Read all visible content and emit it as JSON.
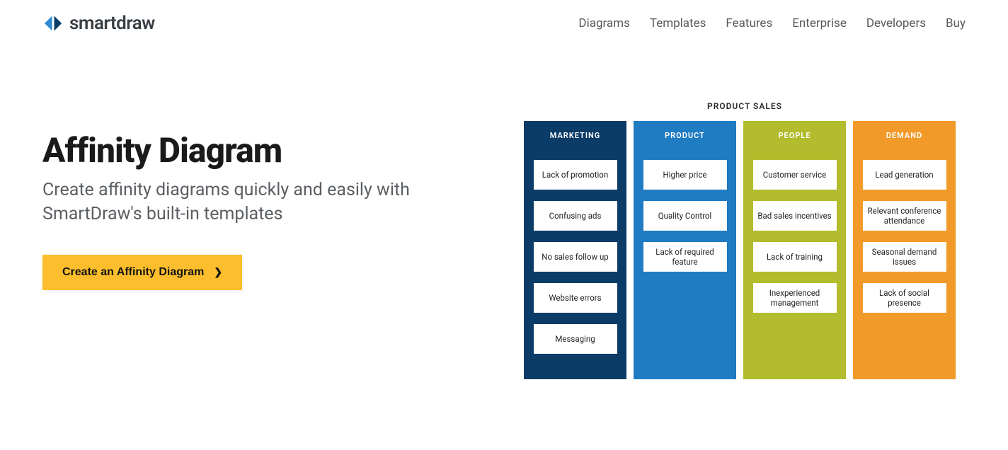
{
  "brand": "smartdraw",
  "nav": [
    "Diagrams",
    "Templates",
    "Features",
    "Enterprise",
    "Developers",
    "Buy"
  ],
  "hero": {
    "title": "Affinity Diagram",
    "subtitle": "Create affinity diagrams quickly and easily with SmartDraw's built-in templates",
    "cta": "Create an Affinity Diagram"
  },
  "diagram": {
    "title": "PRODUCT SALES",
    "columns": [
      {
        "name": "MARKETING",
        "color": "#0b3c68",
        "items": [
          "Lack of promotion",
          "Confusing ads",
          "No sales follow up",
          "Website errors",
          "Messaging"
        ]
      },
      {
        "name": "PRODUCT",
        "color": "#1f7bc2",
        "items": [
          "Higher price",
          "Quality Control",
          "Lack of required feature"
        ]
      },
      {
        "name": "PEOPLE",
        "color": "#b2bc2c",
        "items": [
          "Customer service",
          "Bad sales incentives",
          "Lack of training",
          "Inexperienced management"
        ]
      },
      {
        "name": "DEMAND",
        "color": "#f19a2a",
        "items": [
          "Lead generation",
          "Relevant conference attendance",
          "Seasonal demand issues",
          "Lack of social presence"
        ]
      }
    ]
  }
}
